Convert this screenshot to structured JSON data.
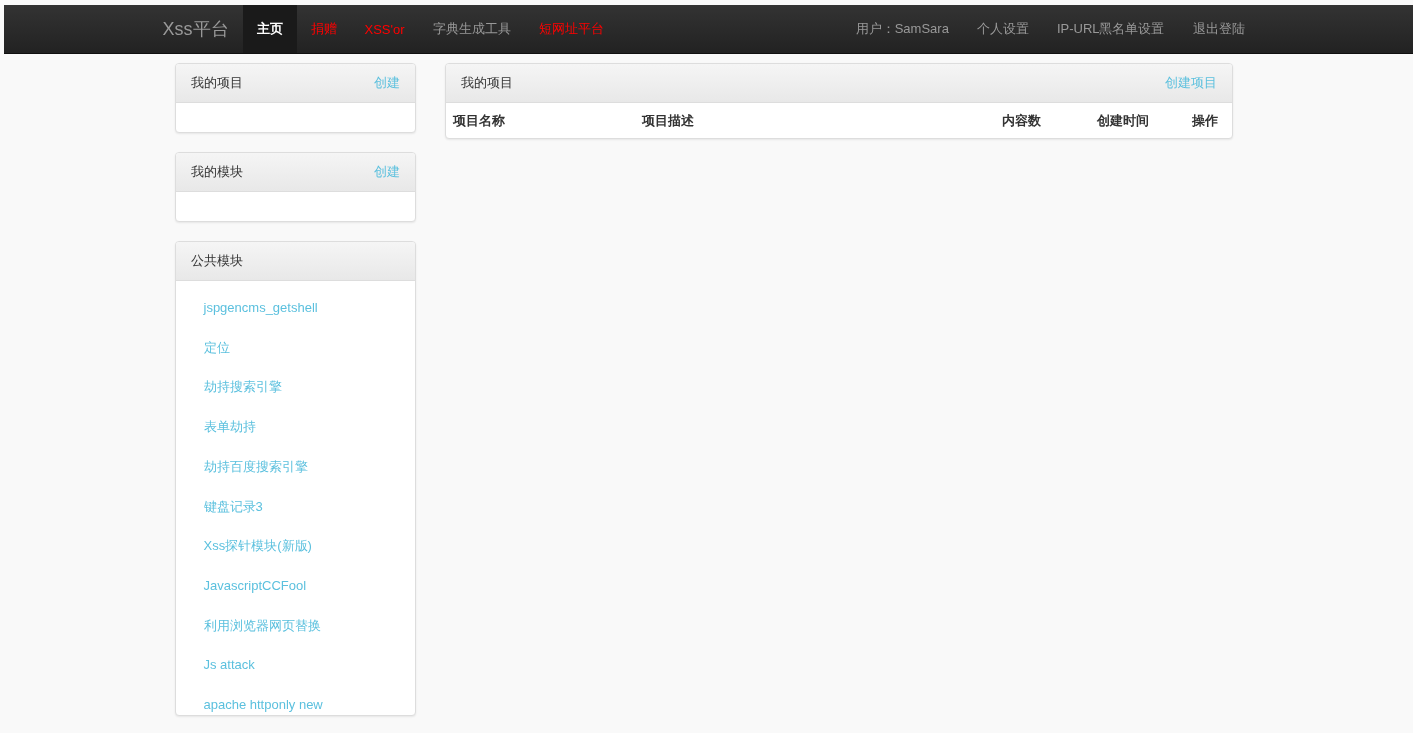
{
  "navbar": {
    "brand": "Xss平台",
    "links": [
      {
        "label": "主页",
        "selected": true,
        "highlighted": false
      },
      {
        "label": "捐赠",
        "selected": false,
        "highlighted": true
      },
      {
        "label": "XSS'or",
        "selected": false,
        "highlighted": true
      },
      {
        "label": "字典生成工具",
        "selected": false,
        "highlighted": false
      },
      {
        "label": "短网址平台",
        "selected": false,
        "highlighted": true
      }
    ],
    "user_links": [
      "用户：SamSara",
      "个人设置",
      "IP-URL黑名单设置",
      "退出登陆"
    ]
  },
  "sidebar": [
    {
      "title": "我的项目",
      "action": "创建"
    },
    {
      "title": "我的模块",
      "action": "创建"
    },
    {
      "title": "公共模块",
      "items": [
        "jspgencms_getshell",
        "定位",
        "劫持搜索引擎",
        "表单劫持",
        "劫持百度搜索引擎",
        "键盘记录3",
        "Xss探针模块(新版)",
        "JavascriptCCFool",
        "利用浏览器网页替换",
        "Js attack",
        "apache httponly new"
      ]
    }
  ],
  "main": {
    "title": "我的项目",
    "action": "创建项目",
    "columns": [
      "项目名称",
      "项目描述",
      "内容数",
      "创建时间",
      "操作"
    ]
  }
}
